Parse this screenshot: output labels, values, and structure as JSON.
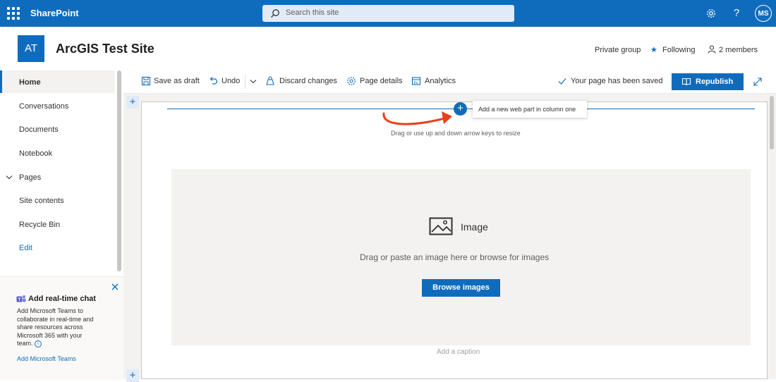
{
  "suite": {
    "brand": "SharePoint",
    "search_placeholder": "Search this site",
    "avatar_initials": "MS"
  },
  "site": {
    "logo_initials": "AT",
    "title": "ArcGIS Test Site",
    "privacy": "Private group",
    "following": "Following",
    "members": "2 members"
  },
  "nav": {
    "items": [
      "Home",
      "Conversations",
      "Documents",
      "Notebook",
      "Pages",
      "Site contents",
      "Recycle Bin"
    ],
    "edit": "Edit"
  },
  "teams_card": {
    "title": "Add real-time chat",
    "body_lines": [
      "Add Microsoft Teams to",
      "collaborate in real-time and",
      "share resources across",
      "Microsoft 365 with your",
      "team."
    ],
    "link": "Add Microsoft Teams"
  },
  "toolbar": {
    "save_draft": "Save as draft",
    "undo": "Undo",
    "discard": "Discard changes",
    "page_details": "Page details",
    "analytics": "Analytics",
    "saved_status": "Your page has been saved",
    "republish": "Republish"
  },
  "canvas": {
    "tooltip": "Add a new web part in column one",
    "resize_hint": "Drag or use up and down arrow keys to resize",
    "image_title": "Image",
    "image_hint": "Drag or paste an image here or browse for images",
    "browse_button": "Browse images",
    "caption_placeholder": "Add a caption"
  },
  "colors": {
    "accent": "#0f6cbd",
    "arrow": "#e8401c"
  }
}
